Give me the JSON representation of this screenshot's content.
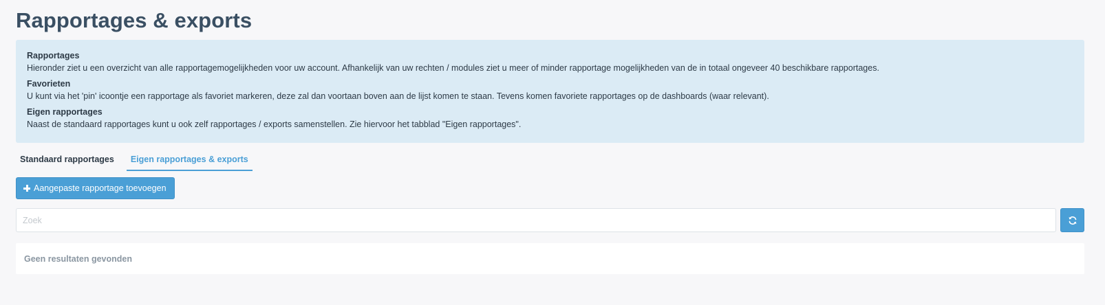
{
  "page": {
    "title": "Rapportages & exports"
  },
  "info": {
    "sections": [
      {
        "heading": "Rapportages",
        "text": "Hieronder ziet u een overzicht van alle rapportagemogelijkheden voor uw account. Afhankelijk van uw rechten / modules ziet u meer of minder rapportage mogelijkheden van de in totaal ongeveer 40 beschikbare rapportages."
      },
      {
        "heading": "Favorieten",
        "text": "U kunt via het 'pin' icoontje een rapportage als favoriet markeren, deze zal dan voortaan boven aan de lijst komen te staan. Tevens komen favoriete rapportages op de dashboards (waar relevant)."
      },
      {
        "heading": "Eigen rapportages",
        "text": "Naast de standaard rapportages kunt u ook zelf rapportages / exports samenstellen. Zie hiervoor het tabblad \"Eigen rapportages\"."
      }
    ]
  },
  "tabs": [
    {
      "label": "Standaard rapportages",
      "active": false
    },
    {
      "label": "Eigen rapportages & exports",
      "active": true
    }
  ],
  "toolbar": {
    "add_label": "Aangepaste rapportage toevoegen",
    "add_icon": "plus-icon",
    "refresh_icon": "refresh-icon"
  },
  "search": {
    "placeholder": "Zoek",
    "value": ""
  },
  "results": {
    "empty_text": "Geen resultaten gevonden"
  },
  "colors": {
    "accent": "#4a9fd6",
    "info_background": "#dbebf5",
    "page_background": "#f7f7f9",
    "title": "#3a4f63"
  }
}
